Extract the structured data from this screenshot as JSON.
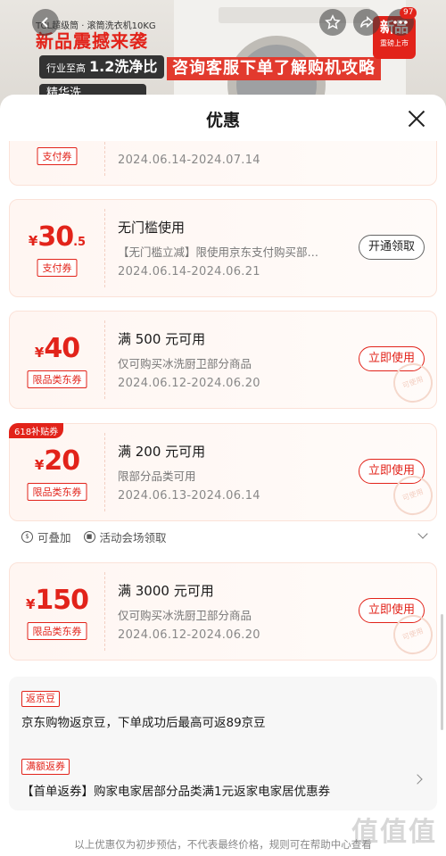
{
  "banner": {
    "brand_line": "TCL超级筒 · 滚筒洗衣机10KG",
    "headline": "新品震撼来袭",
    "badge_prefix": "行业至高",
    "badge_value": "1.2洗净比",
    "badge_second": "精华洗",
    "promo": "咨询客服下单了解购机攻略",
    "corner_title": "新品",
    "corner_sub": "重磅上市",
    "cart_count": "97"
  },
  "sheet": {
    "title": "优惠"
  },
  "coupons": [
    {
      "currency": "¥",
      "amount": "",
      "decimal": "",
      "tag": "支付券",
      "title": "",
      "desc": "",
      "date": "2024.06.14-2024.07.14",
      "action": "",
      "ribbon": "",
      "stamp": ""
    },
    {
      "currency": "¥",
      "amount": "30",
      "decimal": ".5",
      "tag": "支付券",
      "title": "无门槛使用",
      "desc": "【无门槛立减】限使用京东支付购买部…",
      "date": "2024.06.14-2024.06.21",
      "action": "开通领取",
      "ribbon": "",
      "stamp": ""
    },
    {
      "currency": "¥",
      "amount": "40",
      "decimal": "",
      "tag": "限品类东券",
      "title": "满 500 元可用",
      "desc": "仅可购买冰洗厨卫部分商品",
      "date": "2024.06.12-2024.06.20",
      "action": "立即使用",
      "ribbon": "",
      "stamp": "可使用"
    },
    {
      "currency": "¥",
      "amount": "20",
      "decimal": "",
      "tag": "限品类东券",
      "title": "满 200 元可用",
      "desc": "限部分品类可用",
      "date": "2024.06.13-2024.06.14",
      "action": "立即使用",
      "ribbon": "618补贴券",
      "stamp": "可使用"
    },
    {
      "currency": "¥",
      "amount": "150",
      "decimal": "",
      "tag": "限品类东券",
      "title": "满 3000 元可用",
      "desc": "仅可购买冰洗厨卫部分商品",
      "date": "2024.06.12-2024.06.20",
      "action": "立即使用",
      "ribbon": "",
      "stamp": "可使用"
    }
  ],
  "meta": {
    "stackable": "可叠加",
    "venue": "活动会场领取"
  },
  "info": {
    "jd_bean_pill": "返京豆",
    "jd_bean_text": "京东购物返京豆，下单成功后最高可返89京豆",
    "refund_pill": "满额返券",
    "refund_text": "【首单返券】购家电家居部分品类满1元返家电家居优惠券"
  },
  "footnote": "以上优惠仅为初步预估，不代表最终价格，规则可在帮助中心查看",
  "watermark": "值值值"
}
